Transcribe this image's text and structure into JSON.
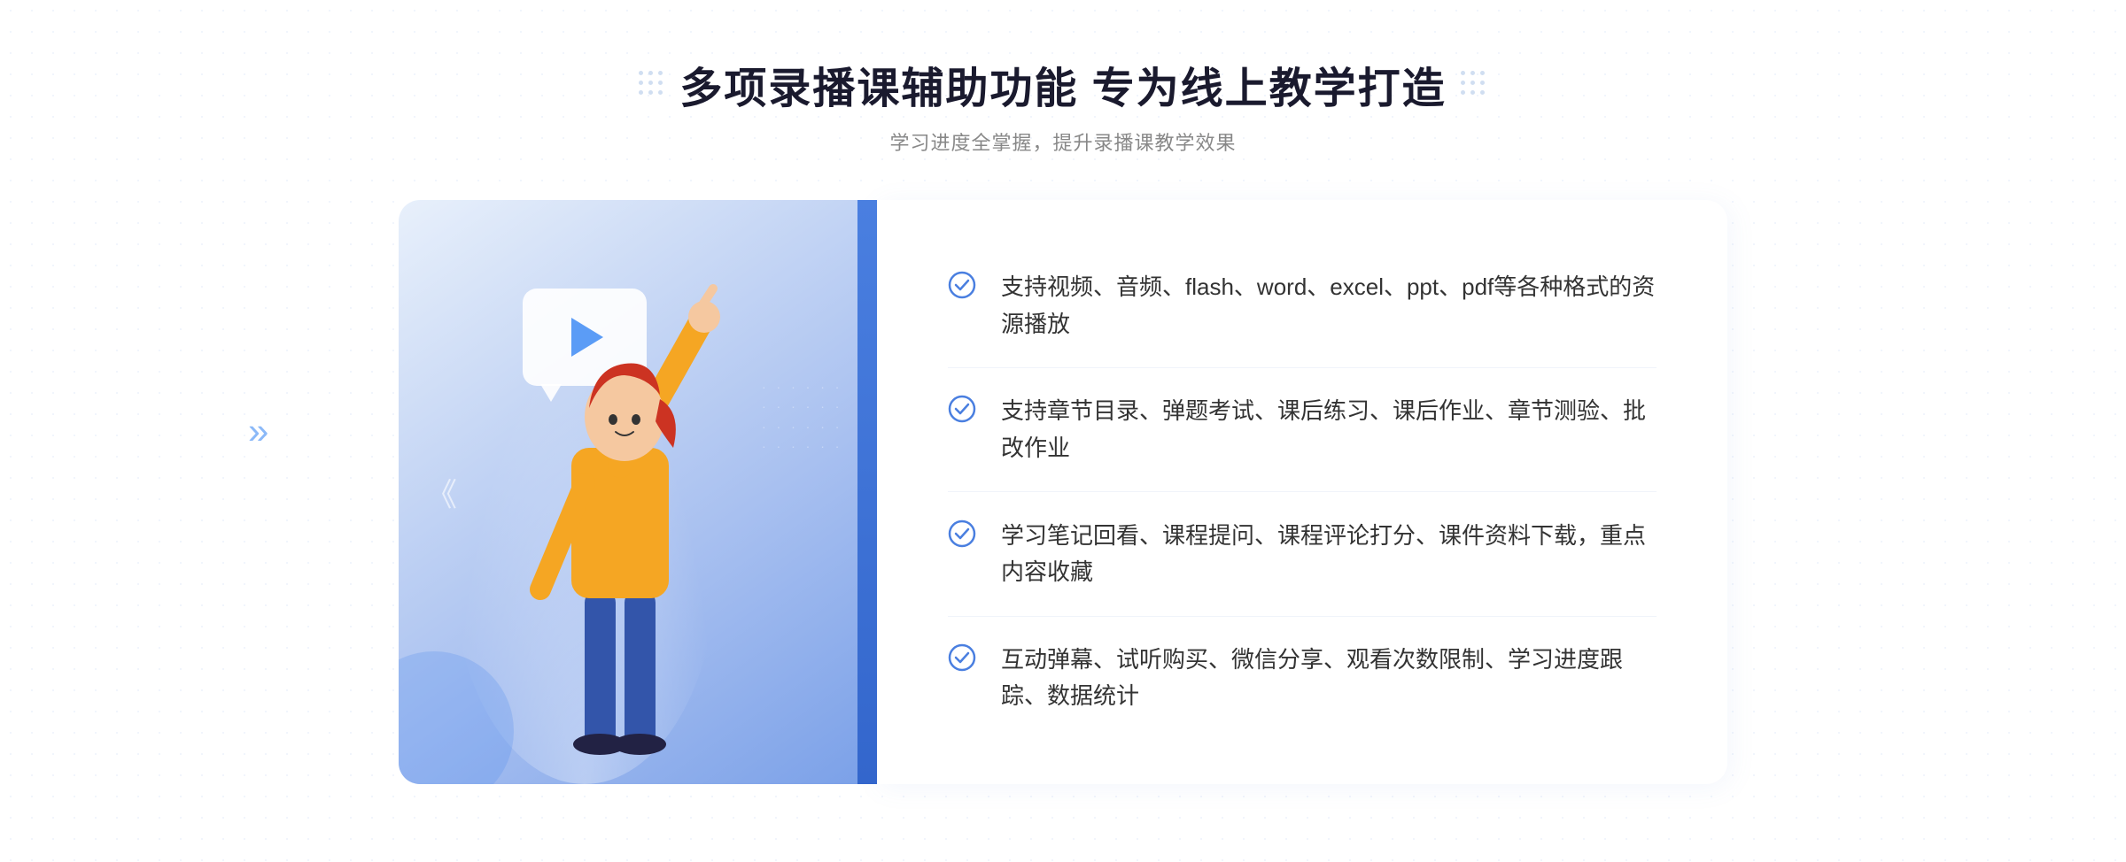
{
  "page": {
    "background": "#f5f7fa"
  },
  "header": {
    "main_title": "多项录播课辅助功能 专为线上教学打造",
    "sub_title": "学习进度全掌握，提升录播课教学效果"
  },
  "features": [
    {
      "id": 1,
      "text": "支持视频、音频、flash、word、excel、ppt、pdf等各种格式的资源播放"
    },
    {
      "id": 2,
      "text": "支持章节目录、弹题考试、课后练习、课后作业、章节测验、批改作业"
    },
    {
      "id": 3,
      "text": "学习笔记回看、课程提问、课程评论打分、课件资料下载，重点内容收藏"
    },
    {
      "id": 4,
      "text": "互动弹幕、试听购买、微信分享、观看次数限制、学习进度跟踪、数据统计"
    }
  ],
  "icons": {
    "check_circle": "check-circle",
    "play": "play-icon",
    "chevron": "»"
  },
  "colors": {
    "accent_blue": "#4a7fe0",
    "light_blue": "#5b9cf6",
    "text_dark": "#1a1a2e",
    "text_gray": "#888",
    "text_body": "#333"
  }
}
